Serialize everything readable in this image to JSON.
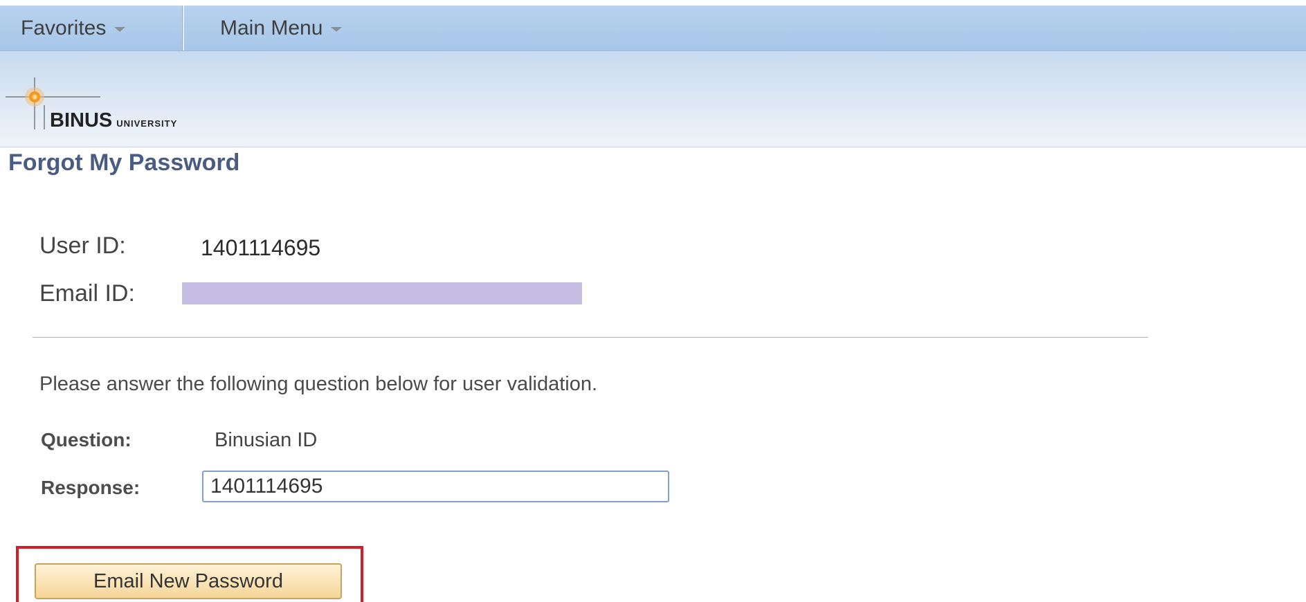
{
  "nav": {
    "favorites": "Favorites",
    "main_menu": "Main Menu"
  },
  "logo": {
    "name": "BINUS",
    "sub": "UNIVERSITY"
  },
  "page_title": "Forgot My Password",
  "user": {
    "user_id_label": "User ID:",
    "user_id_value": "1401114695",
    "email_id_label": "Email ID:"
  },
  "instruction": "Please answer the following question below for user validation.",
  "validation": {
    "question_label": "Question:",
    "question_value": "Binusian ID",
    "response_label": "Response:",
    "response_value": "1401114695"
  },
  "email_button_label": "Email New Password",
  "colors": {
    "nav_bg": "#a7c6e8",
    "title": "#4b5c82",
    "highlight": "#d11f2a",
    "button_bg": "#f6d598",
    "redaction": "#c6bde2"
  }
}
